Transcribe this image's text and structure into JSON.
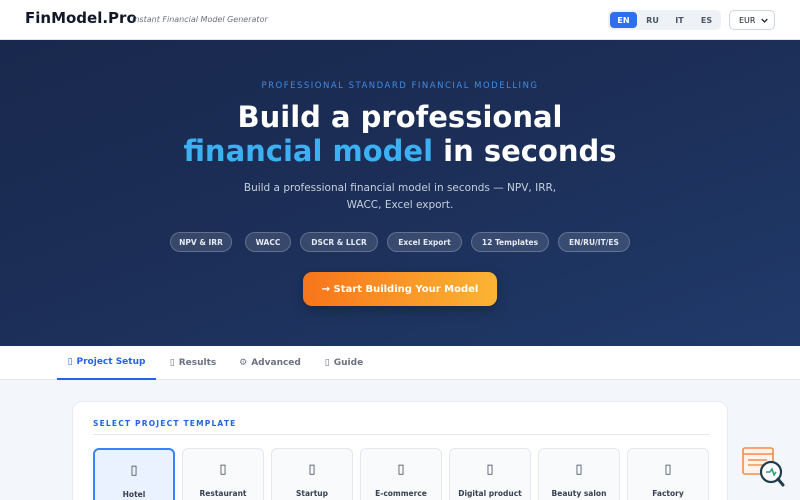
{
  "header": {
    "logo": "FinModel.Pro",
    "tagline": "Instant Financial Model Generator",
    "languages": [
      "EN",
      "RU",
      "IT",
      "ES"
    ],
    "active_language": "EN",
    "currency": "EUR",
    "currency_icon": "chevron-down-icon"
  },
  "hero": {
    "eyebrow": "PROFESSIONAL STANDARD FINANCIAL MODELLING",
    "title_line1": "Build a professional",
    "title_accent": "financial model",
    "title_rest": " in seconds",
    "description": "Build a professional financial model in seconds — NPV, IRR, WACC, Excel export.",
    "features": [
      "NPV & IRR",
      "WACC",
      "DSCR & LLCR",
      "Excel Export",
      "12 Templates",
      "EN/RU/IT/ES"
    ],
    "cta": "→ Start Building Your Model",
    "accent_color": "#3bb0f3"
  },
  "tabs": [
    {
      "label": "Project Setup",
      "icon": "▯",
      "active": true
    },
    {
      "label": "Results",
      "icon": "▯",
      "active": false
    },
    {
      "label": "Advanced",
      "icon": "⚙",
      "active": false
    },
    {
      "label": "Guide",
      "icon": "▯",
      "active": false
    }
  ],
  "main": {
    "section_title": "SELECT PROJECT TEMPLATE",
    "templates": [
      {
        "label": "Hotel",
        "icon": "▯",
        "selected": true
      },
      {
        "label": "Restaurant",
        "icon": "▯",
        "selected": false
      },
      {
        "label": "Startup",
        "icon": "▯",
        "selected": false
      },
      {
        "label": "E-commerce",
        "icon": "▯",
        "selected": false
      },
      {
        "label": "Digital product",
        "icon": "▯",
        "selected": false
      },
      {
        "label": "Beauty salon",
        "icon": "▯",
        "selected": false
      },
      {
        "label": "Factory",
        "icon": "▯",
        "selected": false
      }
    ]
  },
  "colors": {
    "primary": "#2563eb",
    "cta_start": "#f8751b",
    "cta_end": "#fbb434"
  }
}
